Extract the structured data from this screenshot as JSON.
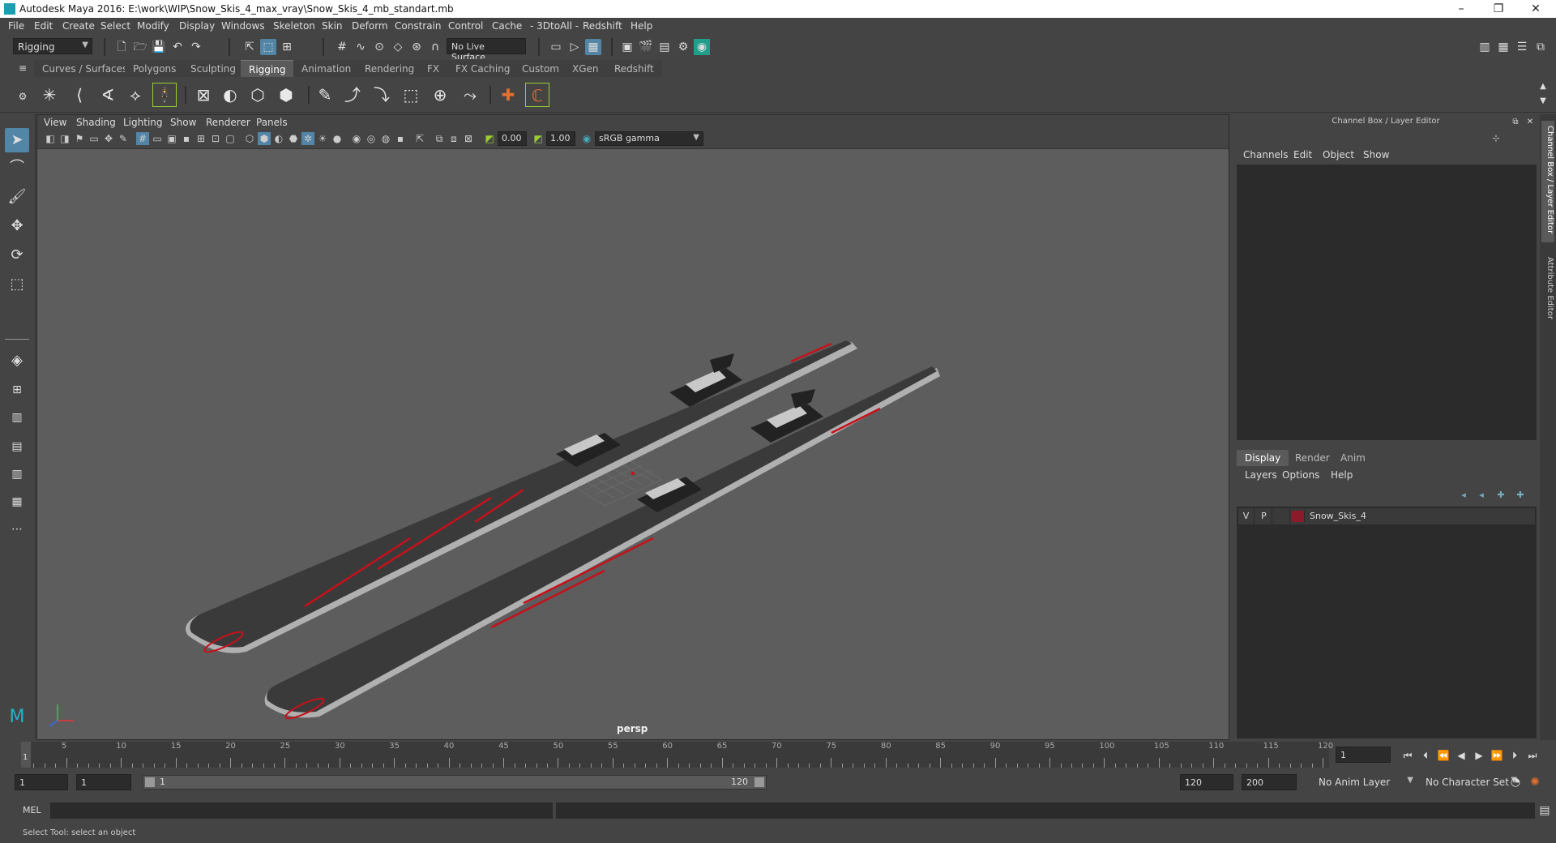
{
  "window": {
    "title": "Autodesk Maya 2016: E:\\work\\WIP\\Snow_Skis_4_max_vray\\Snow_Skis_4_mb_standart.mb",
    "minimize_glyph": "–",
    "restore_glyph": "❐",
    "close_glyph": "✕"
  },
  "menubar": [
    "File",
    "Edit",
    "Create",
    "Select",
    "Modify",
    "Display",
    "Windows",
    "Skeleton",
    "Skin",
    "Deform",
    "Constrain",
    "Control",
    "Cache",
    "- 3DtoAll -",
    "Redshift",
    "Help"
  ],
  "statusline": {
    "menuset": "Rigging",
    "live_surface": "No Live Surface"
  },
  "shelf": {
    "tabs": [
      "Curves / Surfaces",
      "Polygons",
      "Sculpting",
      "Rigging",
      "Animation",
      "Rendering",
      "FX",
      "FX Caching",
      "Custom",
      "XGen",
      "Redshift"
    ],
    "active_tab": "Rigging"
  },
  "viewport": {
    "menu": [
      "View",
      "Shading",
      "Lighting",
      "Show",
      "Renderer",
      "Panels"
    ],
    "exposure": "0.00",
    "gamma": "1.00",
    "color_space": "sRGB gamma",
    "camera": "persp",
    "background": "#5d5d5d"
  },
  "scene": {
    "ski_color": "#3a3a3a",
    "accent_color": "#c8101a",
    "binding_color": "#222222",
    "binding_highlight": "#c8c8c8"
  },
  "channel_box": {
    "title": "Channel Box / Layer Editor",
    "menu": [
      "Channels",
      "Edit",
      "Object",
      "Show"
    ]
  },
  "layer_editor": {
    "tabs": [
      "Display",
      "Render",
      "Anim"
    ],
    "active_tab": "Display",
    "menu": [
      "Layers",
      "Options",
      "Help"
    ],
    "layers": [
      {
        "visible": "V",
        "playback": "P",
        "name": "Snow_Skis_4",
        "color": "#8b1a2b"
      }
    ]
  },
  "side_tabs": [
    "Channel Box / Layer Editor",
    "Attribute Editor"
  ],
  "timeline": {
    "ticks": [
      "5",
      "10",
      "15",
      "20",
      "25",
      "30",
      "35",
      "40",
      "45",
      "50",
      "55",
      "60",
      "65",
      "70",
      "75",
      "80",
      "85",
      "90",
      "95",
      "100",
      "105",
      "110",
      "115",
      "120"
    ],
    "current_frame": "1",
    "current_frame_field": "1"
  },
  "range": {
    "start": "1",
    "playback_start": "1",
    "slider_start": "1",
    "slider_end": "120",
    "playback_end": "120",
    "end": "200",
    "anim_layer": "No Anim Layer",
    "character_set": "No Character Set"
  },
  "command": {
    "language": "MEL"
  },
  "helpline": "Select Tool: select an object"
}
